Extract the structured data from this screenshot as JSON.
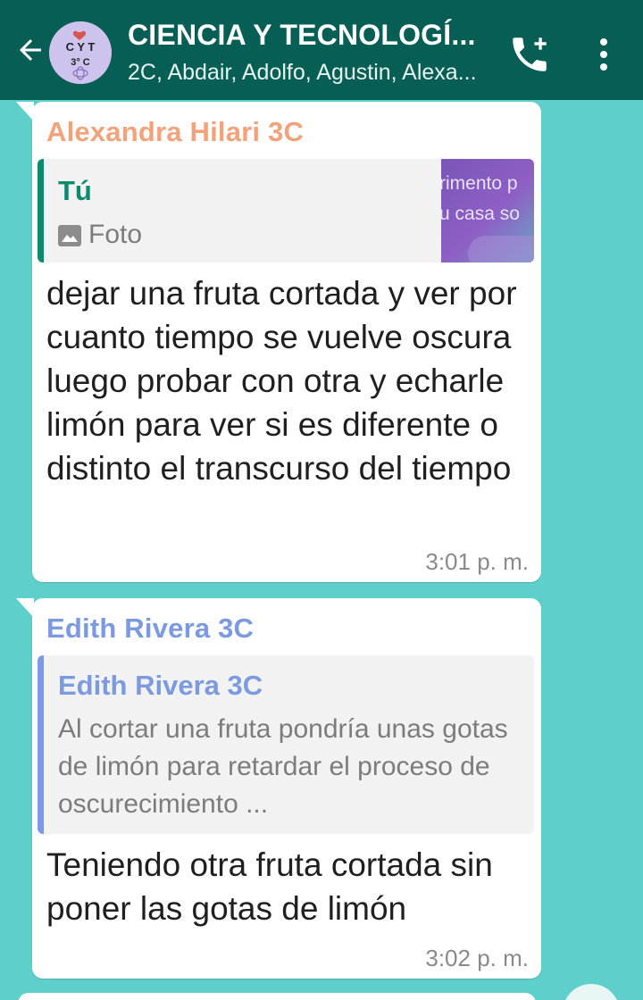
{
  "header": {
    "title": "CIENCIA Y TECNOLOGÍ...",
    "subtitle": "2C, Abdair, Adolfo, Agustin, Alexa...",
    "avatar_text_top": "C Y T",
    "avatar_text_bottom": "3° C",
    "back_icon": "arrow-left-icon",
    "call_icon": "add-call-icon",
    "menu_icon": "more-vert-icon"
  },
  "messages": [
    {
      "sender": "Alexandra Hilari 3C",
      "sender_color": "#f2a37c",
      "quote": {
        "author": "Tú",
        "author_color": "#0c8a6e",
        "bar_color": "#0c8a6e",
        "text": "Foto",
        "thumb_line1": "rimento p",
        "thumb_line2": "u casa so"
      },
      "text": "dejar una fruta cortada y ver por cuanto tiempo se vuelve oscura luego probar con otra y echarle limón para ver si es diferente o distinto el transcurso del tiempo",
      "time": "3:01 p. m."
    },
    {
      "sender": "Edith Rivera 3C",
      "sender_color": "#7b9ae0",
      "quote": {
        "author": "Edith Rivera 3C",
        "author_color": "#7b9ae0",
        "bar_color": "#7b9ae0",
        "text": "Al cortar una fruta pondría unas gotas de limón para retardar el proceso de oscurecimiento ..."
      },
      "text": "Teniendo otra fruta cortada sin poner las gotas de limón",
      "time": "3:02 p. m."
    }
  ]
}
